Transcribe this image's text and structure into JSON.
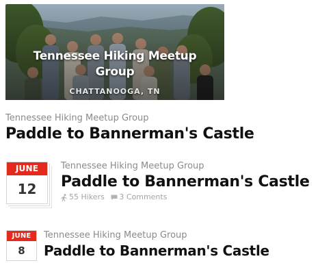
{
  "hero": {
    "title": "Tennessee Hiking Meetup Group",
    "location": "CHATTANOOGA, TN"
  },
  "simple": {
    "group_name": "Tennessee Hiking Meetup Group",
    "event_title": "Paddle to Bannerman's Castle"
  },
  "event_large": {
    "month": "JUNE",
    "day": "12",
    "group_name": "Tennessee Hiking Meetup Group",
    "event_title": "Paddle to Bannerman's Castle",
    "hikers": "55 Hikers",
    "comments": "3 Comments",
    "icons": [
      "hiker-icon",
      "comment-icon"
    ]
  },
  "event_small": {
    "month": "JUNE",
    "day": "8",
    "group_name": "Tennessee Hiking Meetup Group",
    "event_title": "Paddle to Bannerman's Castle"
  },
  "colors": {
    "accent_red": "#e42a1c",
    "muted_text": "#8a8a8a",
    "title_text": "#111111"
  }
}
